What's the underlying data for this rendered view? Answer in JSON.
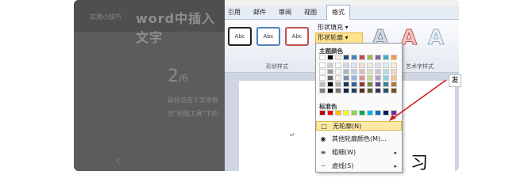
{
  "left_overlay": {
    "tag": "实用小技巧",
    "title": "word中插入文字",
    "step_number": "2",
    "step_suffix": "/6",
    "desc_line1": "鼠标点击下文本框",
    "desc_line2": "览\"绘图工具\"下的",
    "prev_arrow": "‹"
  },
  "ribbon": {
    "tabs": [
      "引用",
      "邮件",
      "审阅",
      "视图",
      "格式"
    ],
    "active_tab": "格式",
    "shape_style_labels": [
      "Abc",
      "Abc",
      "Abc"
    ],
    "shape_fill_label": "形状填充 ▾",
    "shape_outline_label": "形状轮廓 ▾",
    "group_shape_styles": "形状样式",
    "group_art_styles": "艺术字样式",
    "art_letter": "A"
  },
  "menu": {
    "theme_colors_header": "主题颜色",
    "standard_colors_header": "标准色",
    "items": [
      {
        "label": "无轮廓(N)",
        "icon": "none-icon",
        "highlighted": true,
        "arrow": ""
      },
      {
        "label": "其他轮廓颜色(M)...",
        "icon": "palette-icon",
        "highlighted": false,
        "arrow": ""
      },
      {
        "label": "粗细(W)",
        "icon": "line-weight-icon",
        "highlighted": false,
        "arrow": "▸"
      },
      {
        "label": "虚线(S)",
        "icon": "dash-icon",
        "highlighted": false,
        "arrow": "▸"
      }
    ],
    "theme_top_row": [
      "#ffffff",
      "#000000",
      "#eeece1",
      "#1f497d",
      "#4f81bd",
      "#c0504d",
      "#9bbb59",
      "#8064a2",
      "#4bacc6",
      "#f79646"
    ],
    "standard_row": [
      "#c00000",
      "#ff0000",
      "#ffc000",
      "#ffff00",
      "#92d050",
      "#00b050",
      "#00b0f0",
      "#0070c0",
      "#002060",
      "#7030a0"
    ]
  },
  "doc": {
    "glyph": "习",
    "para_mark": "↵"
  },
  "side": {
    "label": "发"
  }
}
